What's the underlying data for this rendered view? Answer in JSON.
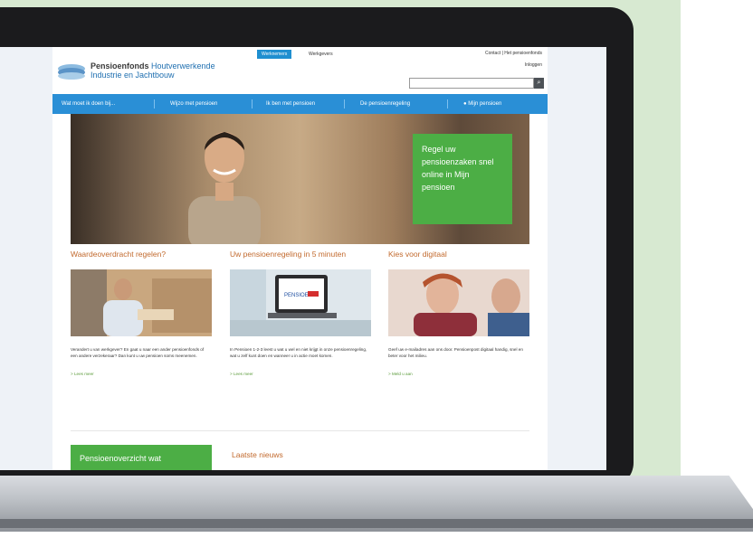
{
  "site": {
    "logo_line1_bold": "Pensioenfonds",
    "logo_line1_rest": "Houtverwerkende",
    "logo_line2": "Industrie en Jachtbouw",
    "tabs": [
      "Werknemers",
      "Werkgevers"
    ],
    "top_links": "Contact  |  Het pensioenfonds",
    "login": "Inloggen",
    "search_icon": "search-icon"
  },
  "nav": {
    "items": [
      "Wat moet ik doen bij...",
      "Wijzo met pensioen",
      "Ik ben met pensioen",
      "De pensioenregeling",
      "Mijn pensioen"
    ]
  },
  "hero": {
    "cta": "Regel uw pensioenzaken snel online in Mijn pensioen"
  },
  "columns": [
    {
      "title": "Waardeoverdracht regelen?",
      "text": "Verandert u van werkgever? En gaat u naar een ander pensioenfonds of een andere verzekeraar? Dan kunt u uw pensioen soms meenemen.",
      "link": "> Lees meer"
    },
    {
      "title": "Uw pensioenregeling in 5 minuten",
      "text": "In Pensioen 1-2-3 leest u wat u wel en niet krijgt in onze pensioenregeling, wat u zelf kunt doen en wanneer u in actie moet komen.",
      "link": "> Lees meer",
      "screen_brand": "PENSIOEN"
    },
    {
      "title": "Kies voor digitaal",
      "text": "Geef uw e-mailadres aan ons door. Pensioenpost digitaal handig, snel en beter voor het milieu.",
      "link": "> Meld u aan"
    }
  ],
  "bottom": {
    "pension_box": "Pensioenoverzicht wat",
    "news_title": "Laatste nieuws"
  },
  "colors": {
    "nav_blue": "#2a8fd6",
    "cta_green": "#4cae45",
    "title_orange": "#c26a2e",
    "background_green": "#d7e9d1"
  }
}
